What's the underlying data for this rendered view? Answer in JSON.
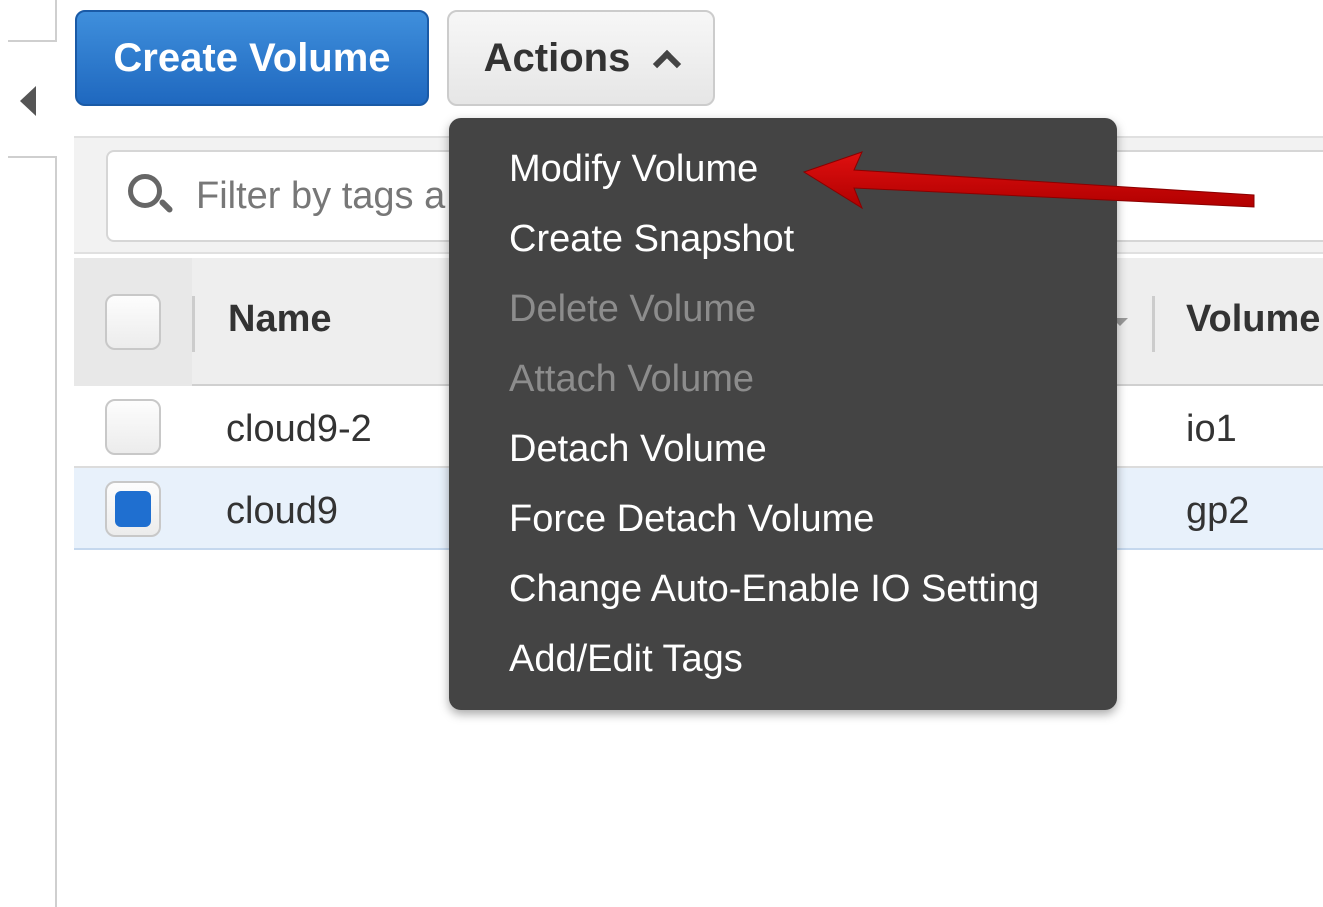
{
  "toolbar": {
    "create_label": "Create Volume",
    "actions_label": "Actions"
  },
  "filter": {
    "placeholder": "Filter by tags a"
  },
  "table": {
    "columns": [
      "Name",
      "Volume"
    ],
    "rows": [
      {
        "name": "cloud9-2",
        "volume_type": "io1",
        "selected": false
      },
      {
        "name": "cloud9",
        "volume_type": "gp2",
        "selected": true
      }
    ]
  },
  "actions_menu": {
    "items": [
      {
        "label": "Modify Volume",
        "enabled": true
      },
      {
        "label": "Create Snapshot",
        "enabled": true
      },
      {
        "label": "Delete Volume",
        "enabled": false
      },
      {
        "label": "Attach Volume",
        "enabled": false
      },
      {
        "label": "Detach Volume",
        "enabled": true
      },
      {
        "label": "Force Detach Volume",
        "enabled": true
      },
      {
        "label": "Change Auto-Enable IO Setting",
        "enabled": true
      },
      {
        "label": "Add/Edit Tags",
        "enabled": true
      }
    ]
  },
  "icons": {
    "search": "search-icon",
    "actions_caret": "chevron-up-icon",
    "collapse": "collapse-left-icon",
    "annotation": "red-arrow-icon"
  },
  "colors": {
    "primary_button": "#1f68bf",
    "menu_background": "#444444",
    "menu_disabled_text": "#8c8c8c",
    "selected_row": "#e8f1fb",
    "checkbox_checked": "#1f6fd0",
    "annotation_arrow": "#cc0000"
  }
}
